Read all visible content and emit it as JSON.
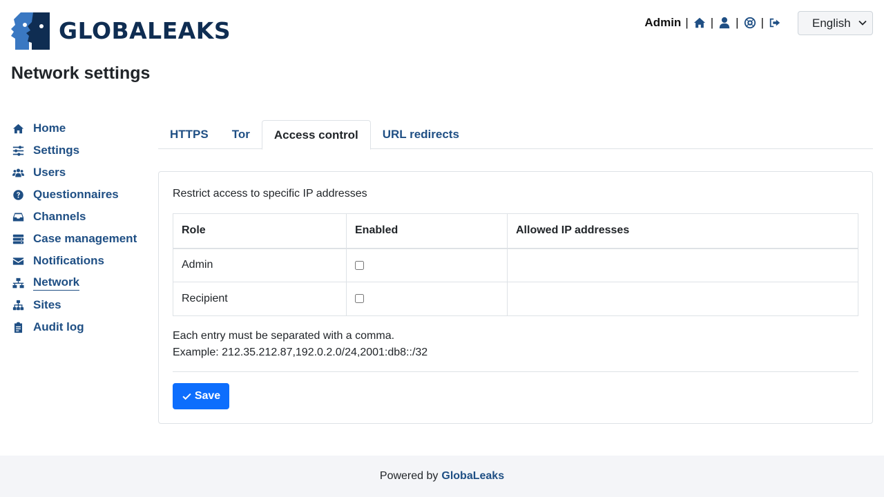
{
  "header": {
    "logo_text": "GLOBALEAKS",
    "username": "Admin",
    "icons": [
      "home-icon",
      "user-icon",
      "support-icon",
      "logout-icon"
    ],
    "language": "English"
  },
  "page_title": "Network settings",
  "sidebar": {
    "items": [
      {
        "label": "Home",
        "icon": "home-icon"
      },
      {
        "label": "Settings",
        "icon": "sliders-icon"
      },
      {
        "label": "Users",
        "icon": "users-icon"
      },
      {
        "label": "Questionnaires",
        "icon": "question-circle-icon"
      },
      {
        "label": "Channels",
        "icon": "inbox-icon"
      },
      {
        "label": "Case management",
        "icon": "stack-icon"
      },
      {
        "label": "Notifications",
        "icon": "envelope-icon"
      },
      {
        "label": "Network",
        "icon": "network-icon",
        "active": true
      },
      {
        "label": "Sites",
        "icon": "sitemap-icon"
      },
      {
        "label": "Audit log",
        "icon": "clipboard-icon"
      }
    ]
  },
  "tabs": [
    {
      "label": "HTTPS"
    },
    {
      "label": "Tor"
    },
    {
      "label": "Access control",
      "active": true
    },
    {
      "label": "URL redirects"
    }
  ],
  "card": {
    "description": "Restrict access to specific IP addresses",
    "table": {
      "headers": [
        "Role",
        "Enabled",
        "Allowed IP addresses"
      ],
      "rows": [
        {
          "role": "Admin",
          "enabled": false,
          "allowed": ""
        },
        {
          "role": "Recipient",
          "enabled": false,
          "allowed": ""
        }
      ]
    },
    "help_line1": "Each entry must be separated with a comma.",
    "help_line2": "Example: 212.35.212.87,192.0.2.0/24,2001:db8::/32",
    "save_label": "Save"
  },
  "footer": {
    "prefix": "Powered by",
    "link": "GlobaLeaks"
  },
  "colors": {
    "brand": "#1f4f84",
    "primary_button": "#0d6efd",
    "footer_bg": "#f4f5f8"
  }
}
